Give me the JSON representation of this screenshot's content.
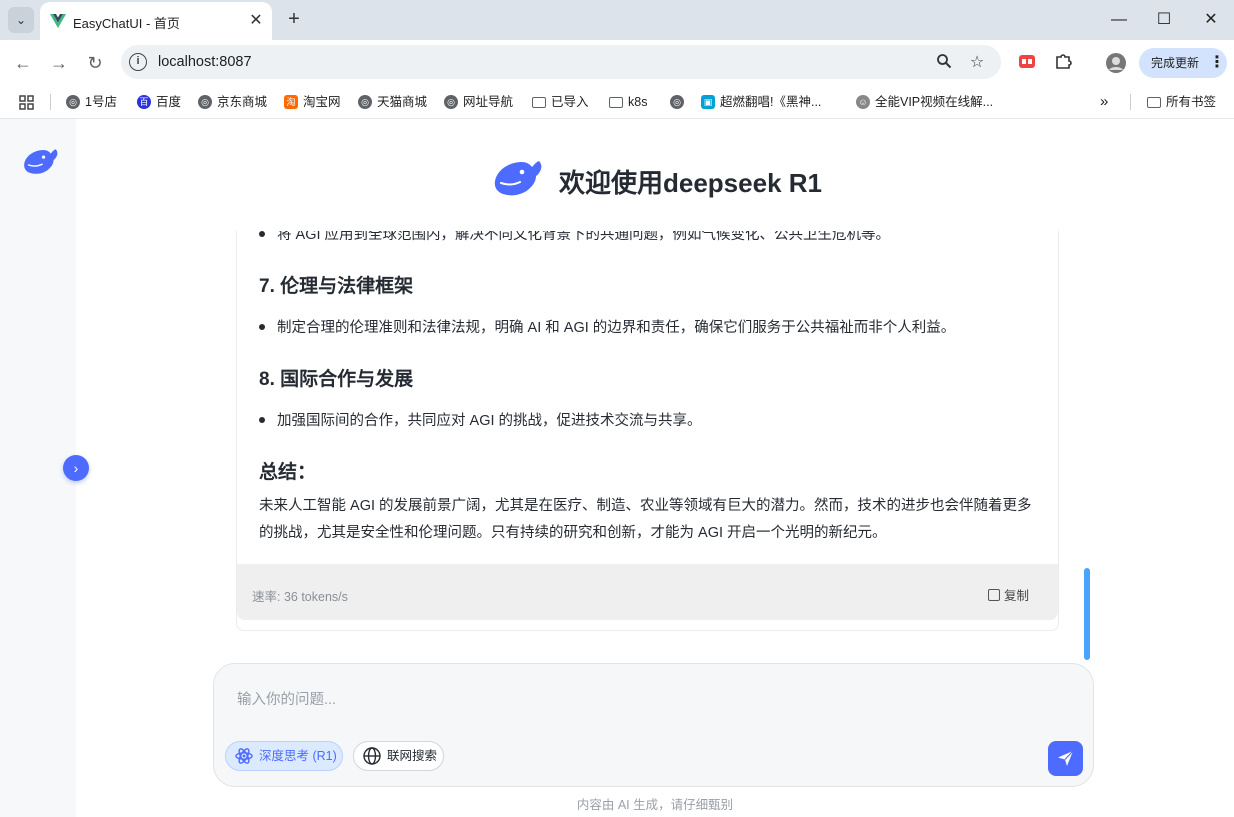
{
  "browser": {
    "tab_title": "EasyChatUI - 首页",
    "url": "localhost:8087",
    "update_label": "完成更新",
    "bookmarks": [
      "1号店",
      "百度",
      "京东商城",
      "淘宝网",
      "天猫商城",
      "网址导航",
      "已导入",
      "k8s",
      "超燃翻唱!《黑神...",
      "全能VIP视频在线解...",
      "所有书签"
    ]
  },
  "app": {
    "title": "欢迎使用deepseek R1",
    "brand_color": "#4d6bfe"
  },
  "message": {
    "bullet_top": "将 AGI 应用到全球范围内，解决不同文化背景下的共通问题，例如气候变化、公共卫生危机等。",
    "h7": "7. 伦理与法律框架",
    "bullet_7": "制定合理的伦理准则和法律法规，明确 AI 和 AGI 的边界和责任，确保它们服务于公共福祉而非个人利益。",
    "h8": "8. 国际合作与发展",
    "bullet_8": "加强国际间的合作，共同应对 AGI 的挑战，促进技术交流与共享。",
    "summary_title": "总结：",
    "summary_text": "未来人工智能 AGI 的发展前景广阔，尤其是在医疗、制造、农业等领域有巨大的潜力。然而，技术的进步也会伴随着更多的挑战，尤其是安全性和伦理问题。只有持续的研究和创新，才能为 AGI 开启一个光明的新纪元。",
    "rate": "速率: 36 tokens/s",
    "copy_label": "复制"
  },
  "input": {
    "placeholder": "输入你的问题...",
    "deep_think_label": "深度思考 (R1)",
    "web_search_label": "联网搜索"
  },
  "disclaimer": "内容由 AI 生成，请仔细甄别"
}
